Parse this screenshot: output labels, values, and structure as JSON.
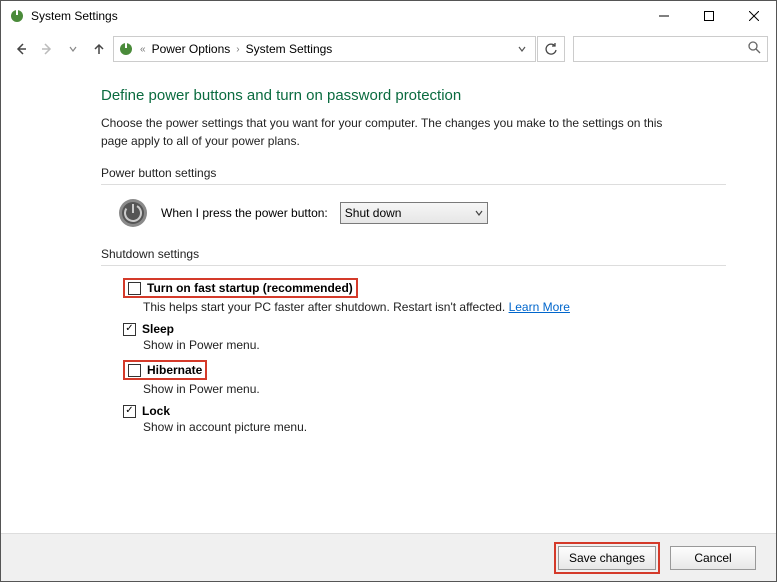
{
  "window": {
    "title": "System Settings"
  },
  "breadcrumb": {
    "lead": "«",
    "items": [
      "Power Options",
      "System Settings"
    ]
  },
  "content": {
    "heading": "Define power buttons and turn on password protection",
    "description": "Choose the power settings that you want for your computer. The changes you make to the settings on this page apply to all of your power plans.",
    "power_section_title": "Power button settings",
    "power_button_label": "When I press the power button:",
    "power_button_value": "Shut down",
    "shutdown_section_title": "Shutdown settings",
    "options": {
      "fast_startup": {
        "label": "Turn on fast startup (recommended)",
        "desc_prefix": "This helps start your PC faster after shutdown. Restart isn't affected. ",
        "learn_more": "Learn More",
        "checked": false
      },
      "sleep": {
        "label": "Sleep",
        "desc": "Show in Power menu.",
        "checked": true
      },
      "hibernate": {
        "label": "Hibernate",
        "desc": "Show in Power menu.",
        "checked": false
      },
      "lock": {
        "label": "Lock",
        "desc": "Show in account picture menu.",
        "checked": true
      }
    }
  },
  "footer": {
    "save": "Save changes",
    "cancel": "Cancel"
  }
}
